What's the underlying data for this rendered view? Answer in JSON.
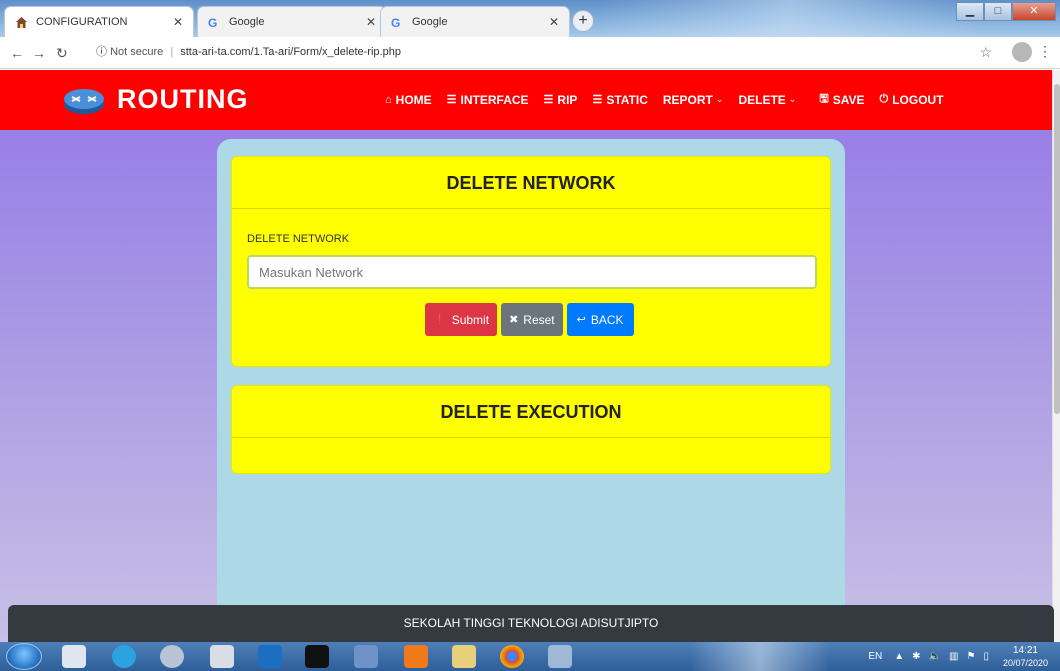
{
  "browser": {
    "tabs": [
      {
        "title": "CONFIGURATION",
        "active": true,
        "favicon": "home-icon"
      },
      {
        "title": "Google",
        "active": false,
        "favicon": "google-icon"
      },
      {
        "title": "Google",
        "active": false,
        "favicon": "google-icon"
      }
    ],
    "security_label": "Not secure",
    "url": "stta-ari-ta.com/1.Ta-ari/Form/x_delete-rip.php"
  },
  "navbar": {
    "brand": "ROUTING",
    "brand_color": "#ff0000",
    "menu": [
      {
        "label": "HOME",
        "icon": "home-icon",
        "dropdown": false
      },
      {
        "label": "INTERFACE",
        "icon": "list-icon",
        "dropdown": false
      },
      {
        "label": "RIP",
        "icon": "list-icon",
        "dropdown": false
      },
      {
        "label": "STATIC",
        "icon": "list-icon",
        "dropdown": false
      },
      {
        "label": "REPORT",
        "icon": "",
        "dropdown": true
      },
      {
        "label": "DELETE",
        "icon": "",
        "dropdown": true
      },
      {
        "label": "SAVE",
        "icon": "save-icon",
        "dropdown": false
      },
      {
        "label": "LOGOUT",
        "icon": "power-icon",
        "dropdown": false
      }
    ]
  },
  "form_card": {
    "title": "DELETE NETWORK",
    "field_label": "DELETE NETWORK",
    "input_placeholder": "Masukan Network",
    "input_value": "",
    "buttons": {
      "submit": "Submit",
      "reset": "Reset",
      "back": "BACK"
    }
  },
  "execution_card": {
    "title": "DELETE EXECUTION"
  },
  "footer": {
    "text": "SEKOLAH TINGGI TEKNOLOGI ADISUTJIPTO"
  },
  "taskbar": {
    "language": "EN",
    "time": "14:21",
    "date": "20/07/2020"
  }
}
